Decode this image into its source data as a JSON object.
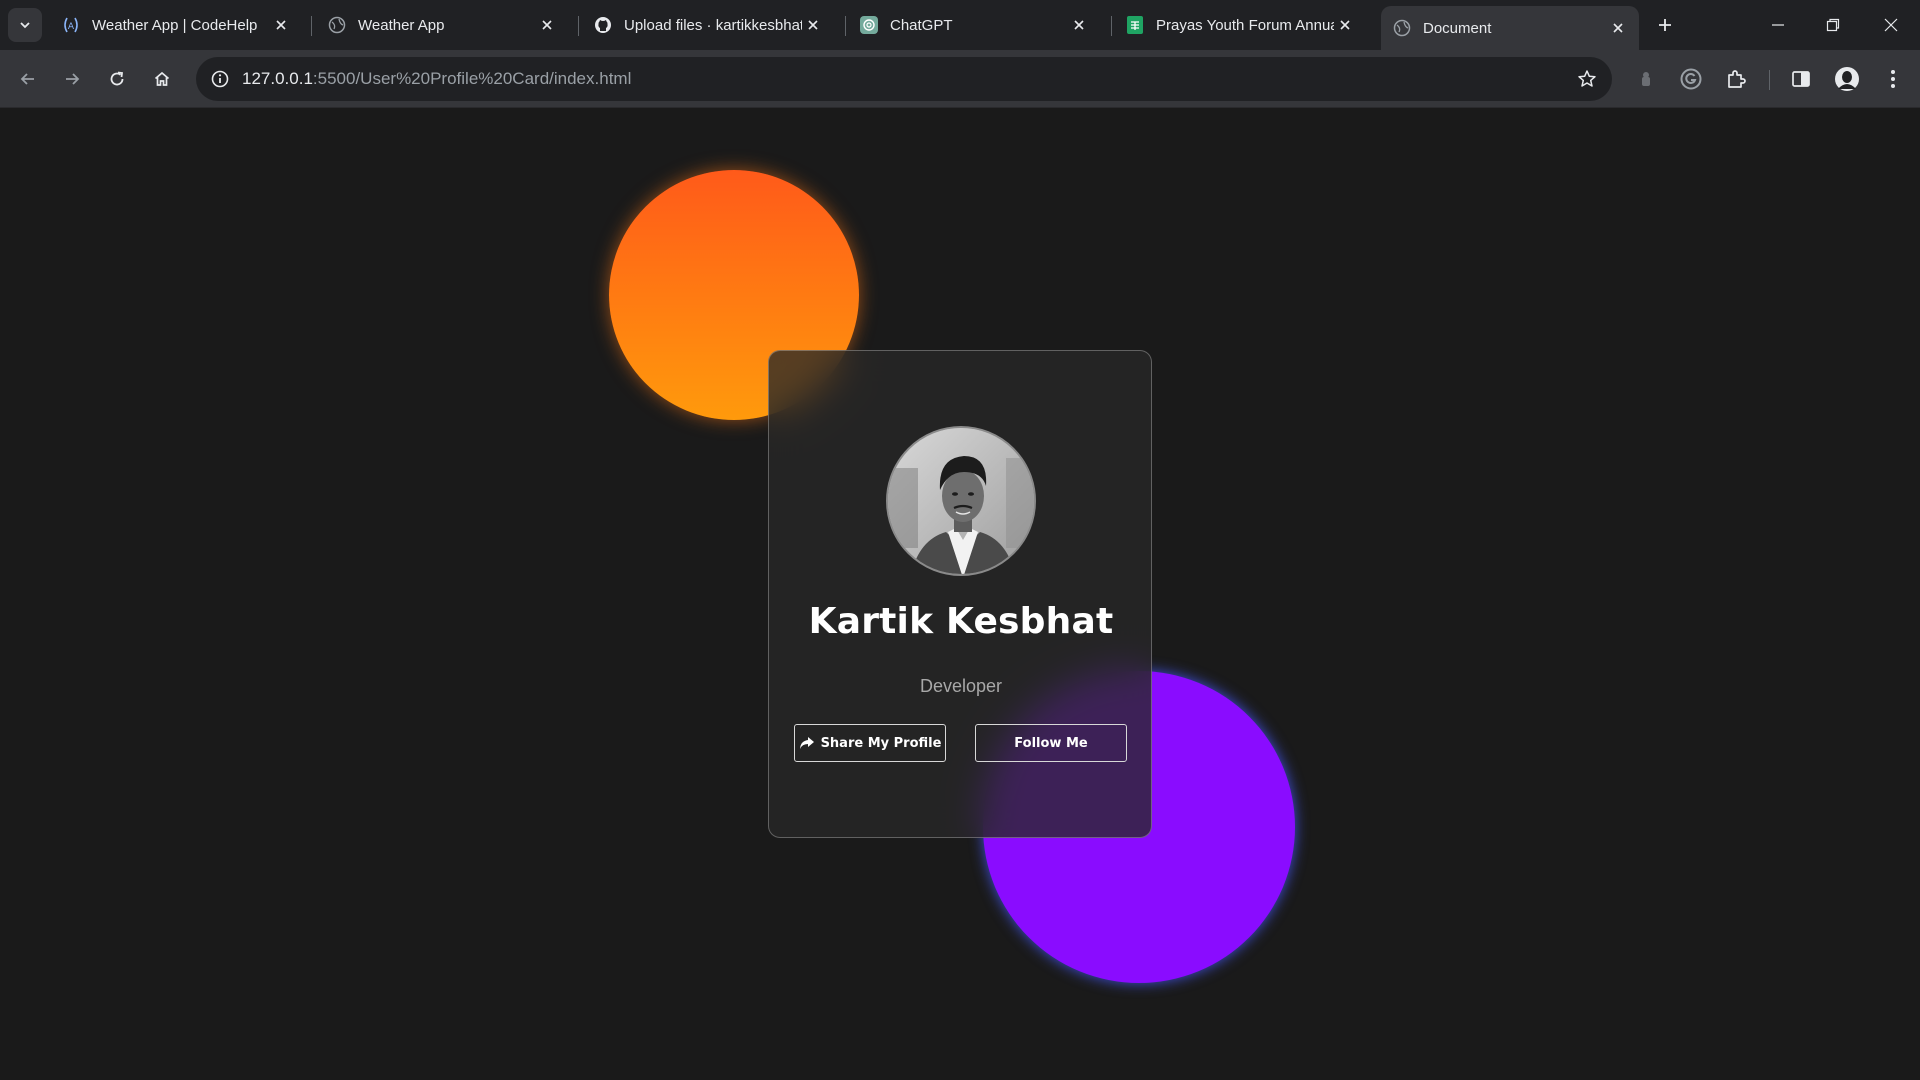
{
  "browser": {
    "tabs": [
      {
        "title": "Weather App | CodeHelp",
        "icon": "codehelp-icon"
      },
      {
        "title": "Weather App",
        "icon": "globe-icon"
      },
      {
        "title": "Upload files · kartikkesbhat",
        "icon": "github-icon"
      },
      {
        "title": "ChatGPT",
        "icon": "chatgpt-icon"
      },
      {
        "title": "Prayas Youth Forum Annual",
        "icon": "sheets-icon"
      },
      {
        "title": "Document",
        "icon": "globe-icon",
        "active": true
      }
    ],
    "url_host": "127.0.0.1",
    "url_path": ":5500/User%20Profile%20Card/index.html"
  },
  "profile": {
    "name": "Kartik Kesbhat",
    "role": "Developer",
    "share_label": "Share My Profile",
    "follow_label": "Follow Me"
  },
  "colors": {
    "page_bg": "#1a1a1a",
    "orange": "#ff7a12",
    "purple": "#8a0cff"
  }
}
